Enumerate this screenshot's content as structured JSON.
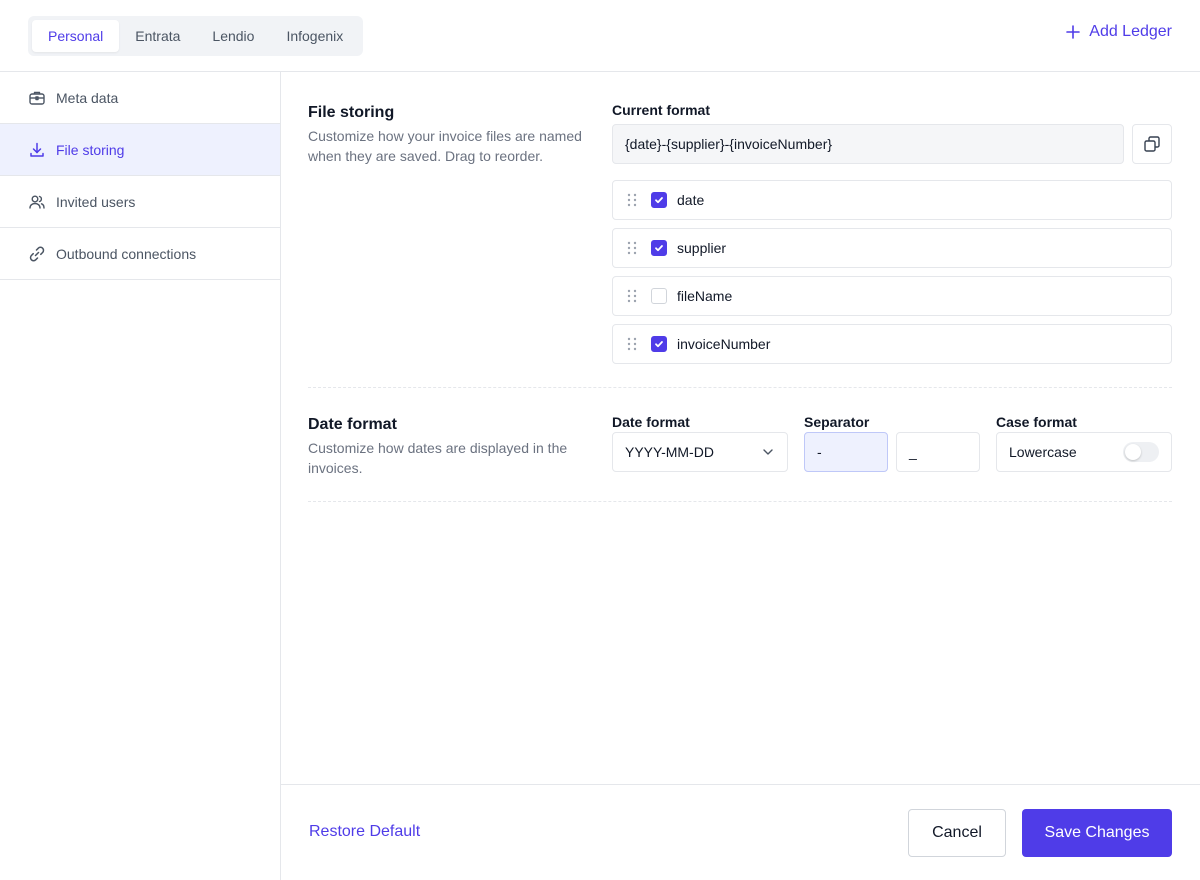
{
  "header": {
    "tabs": [
      {
        "label": "Personal",
        "active": true
      },
      {
        "label": "Entrata",
        "active": false
      },
      {
        "label": "Lendio",
        "active": false
      },
      {
        "label": "Infogenix",
        "active": false
      }
    ],
    "add_ledger_label": "Add Ledger",
    "add_ledger_icon": "plus-icon"
  },
  "sidebar": {
    "items": [
      {
        "label": "Meta data",
        "icon": "briefcase-icon",
        "active": false
      },
      {
        "label": "File storing",
        "icon": "download-icon",
        "active": true
      },
      {
        "label": "Invited users",
        "icon": "users-icon",
        "active": false
      },
      {
        "label": "Outbound connections",
        "icon": "link-icon",
        "active": false
      }
    ]
  },
  "file_storing": {
    "title": "File storing",
    "description": "Customize how your invoice files are named when they are saved. Drag to reorder.",
    "current_format_label": "Current format",
    "current_format_value": "{date}-{supplier}-{invoiceNumber}",
    "tokens": [
      {
        "label": "date",
        "checked": true
      },
      {
        "label": "supplier",
        "checked": true
      },
      {
        "label": "fileName",
        "checked": false
      },
      {
        "label": "invoiceNumber",
        "checked": true
      }
    ]
  },
  "date_format": {
    "title": "Date format",
    "description": "Customize how dates are displayed in the invoices.",
    "date_format_label": "Date format",
    "date_format_value": "YYYY-MM-DD",
    "separator_label": "Separator",
    "separators": [
      "-",
      "_"
    ],
    "selected_separator": "-",
    "case_format_label": "Case format",
    "case_format_value": "Lowercase",
    "case_toggle_on": false
  },
  "footer": {
    "restore_label": "Restore Default",
    "cancel_label": "Cancel",
    "save_label": "Save Changes"
  },
  "colors": {
    "accent": "#4f3ce8",
    "active_bg": "#eef1fe",
    "border": "#e5e7eb",
    "muted_text": "#6b7280"
  }
}
